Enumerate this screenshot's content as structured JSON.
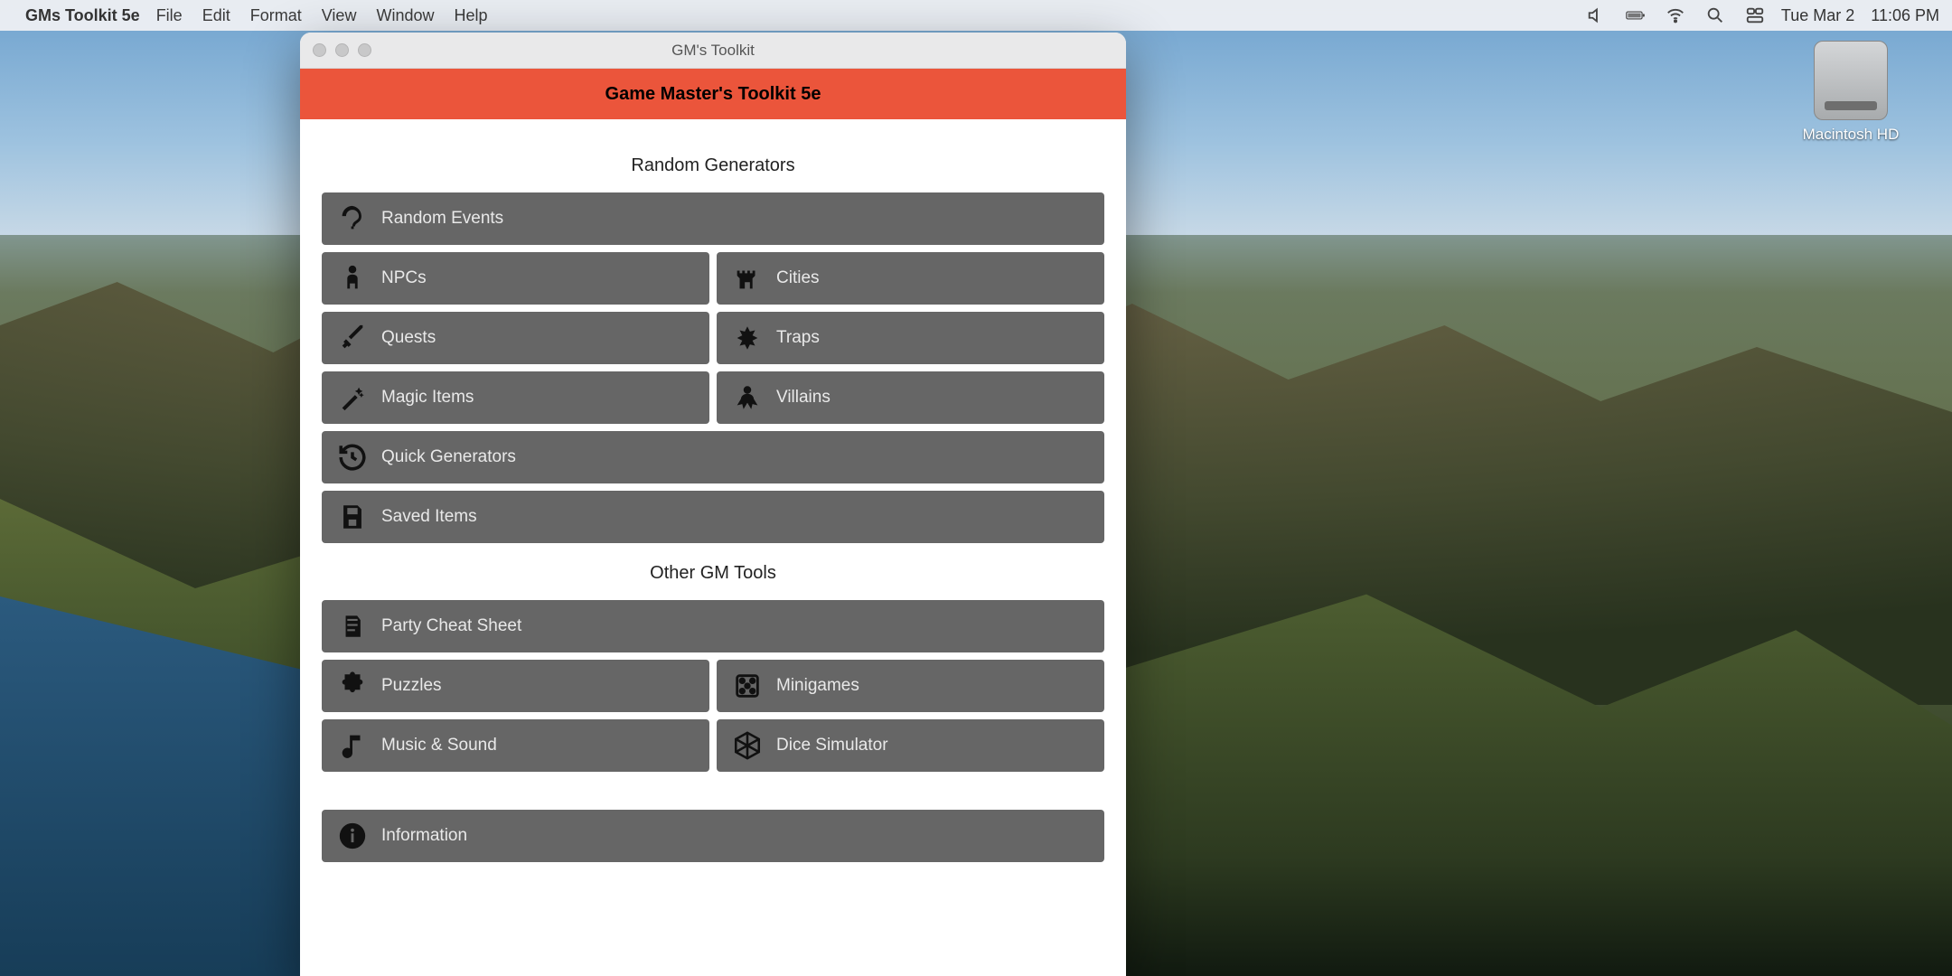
{
  "menubar": {
    "app_name": "GMs Toolkit 5e",
    "items": [
      "File",
      "Edit",
      "Format",
      "View",
      "Window",
      "Help"
    ],
    "date": "Tue Mar 2",
    "time": "11:06 PM"
  },
  "desktop": {
    "drive_label": "Macintosh HD"
  },
  "window": {
    "title": "GM's Toolkit",
    "banner": "Game Master's Toolkit 5e",
    "sections": {
      "generators_title": "Random Generators",
      "tools_title": "Other GM Tools"
    },
    "tiles": {
      "random_events": "Random Events",
      "npcs": "NPCs",
      "cities": "Cities",
      "quests": "Quests",
      "traps": "Traps",
      "magic_items": "Magic Items",
      "villains": "Villains",
      "quick_generators": "Quick Generators",
      "saved_items": "Saved Items",
      "party_cheat_sheet": "Party Cheat Sheet",
      "puzzles": "Puzzles",
      "minigames": "Minigames",
      "music_sound": "Music & Sound",
      "dice_simulator": "Dice Simulator",
      "information": "Information"
    }
  },
  "colors": {
    "banner": "#eb553b",
    "tile": "#666666"
  }
}
